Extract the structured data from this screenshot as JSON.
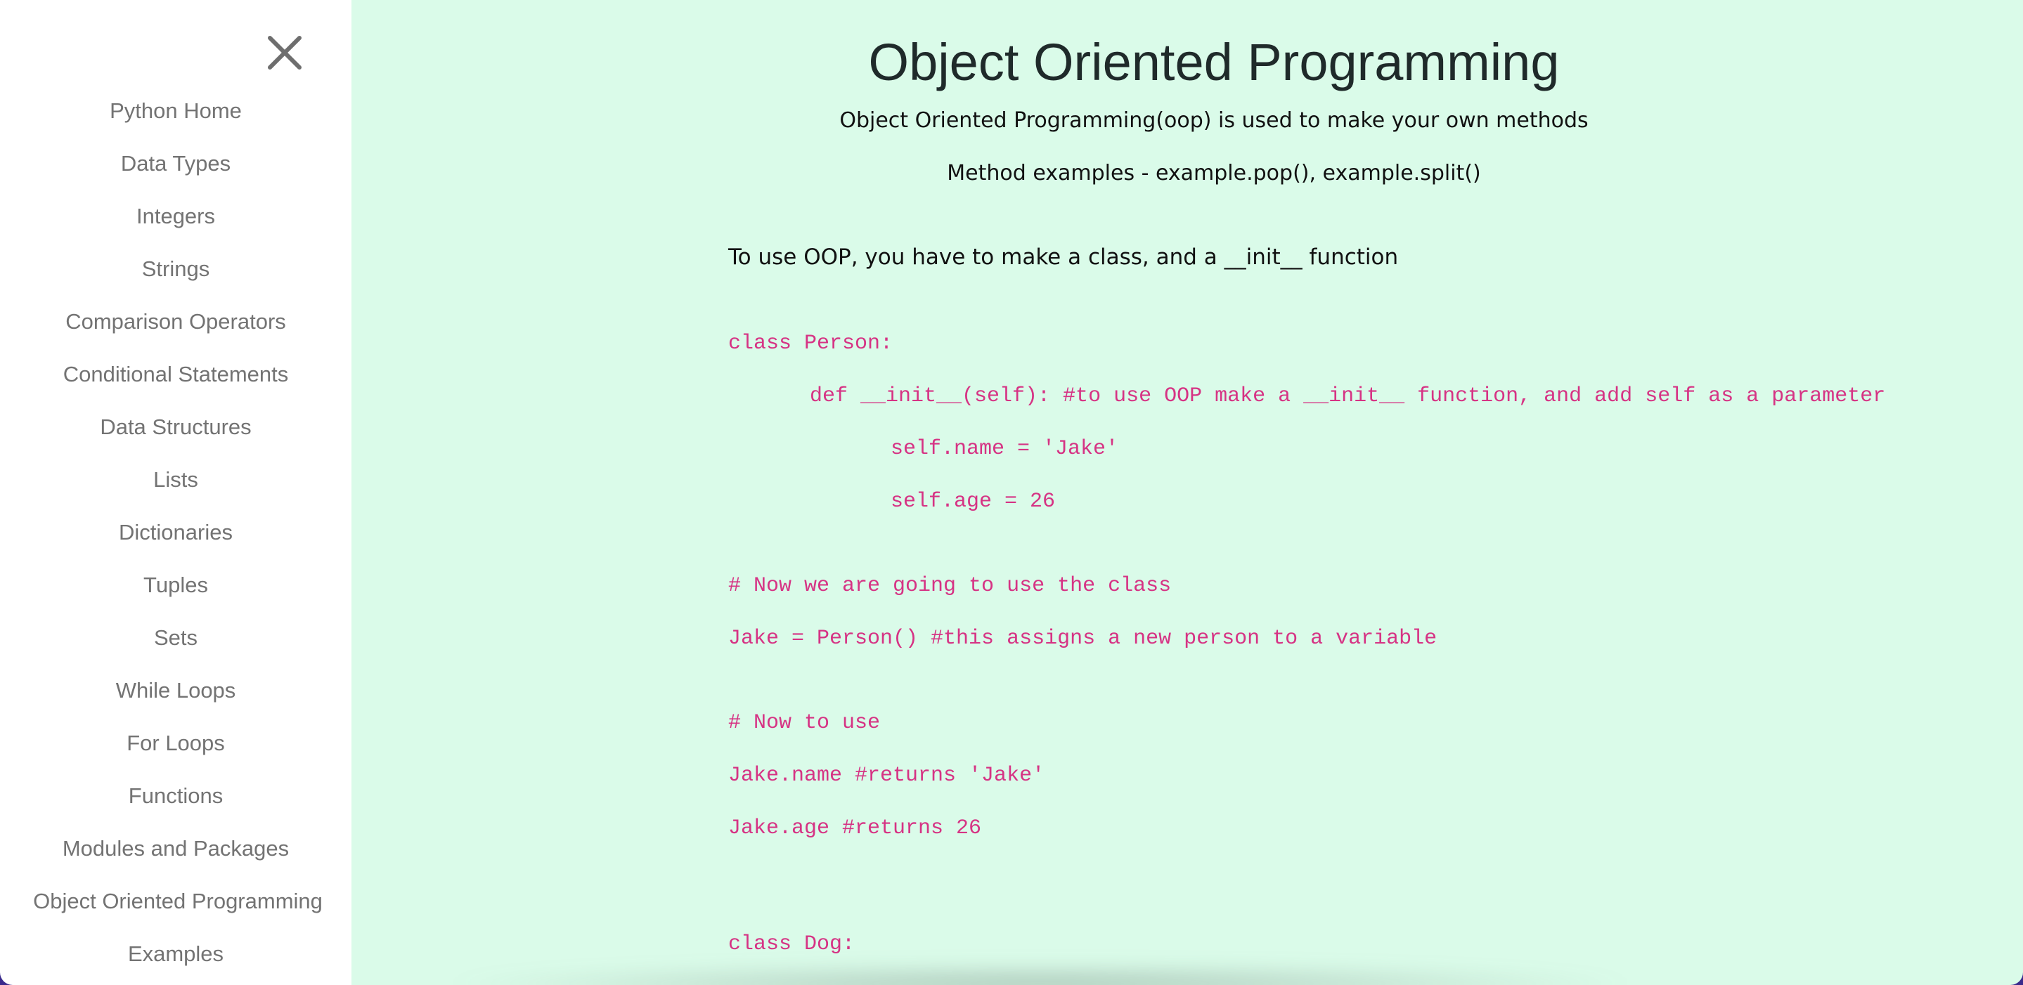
{
  "sidebar": {
    "close_glyph": "✕",
    "items": [
      {
        "label": "Python Home"
      },
      {
        "label": "Data Types"
      },
      {
        "label": "Integers"
      },
      {
        "label": "Strings"
      },
      {
        "label": "Comparison Operators"
      },
      {
        "label": "Conditional Statements"
      },
      {
        "label": "Data Structures"
      },
      {
        "label": "Lists"
      },
      {
        "label": "Dictionaries"
      },
      {
        "label": "Tuples"
      },
      {
        "label": "Sets"
      },
      {
        "label": "While Loops"
      },
      {
        "label": "For Loops"
      },
      {
        "label": "Functions"
      },
      {
        "label": "Modules and Packages"
      },
      {
        "label": "Object Oriented Programming"
      },
      {
        "label": "Examples"
      }
    ]
  },
  "main": {
    "title": "Object Oriented Programming",
    "subtitle": "Object Oriented Programming(oop) is used to make your own methods",
    "method_examples": "Method examples - example.pop(), example.split()",
    "intro": "To use OOP, you have to make a class, and a __init__ function",
    "code": [
      "class Person:",
      "def __init__(self): #to use OOP make a __init__ function, and add self as a parameter",
      "self.name = 'Jake'",
      "self.age = 26",
      "# Now we are going to use the class",
      "Jake = Person() #this assigns a new person to a variable",
      "# Now to use",
      "Jake.name #returns 'Jake'",
      "Jake.age #returns 26",
      "class Dog:"
    ]
  },
  "colors": {
    "sidebar_bg": "#ffffff",
    "content_bg": "#dafbe9",
    "nav_text": "#737373",
    "code_text": "#d63384",
    "body_text": "#111111"
  }
}
